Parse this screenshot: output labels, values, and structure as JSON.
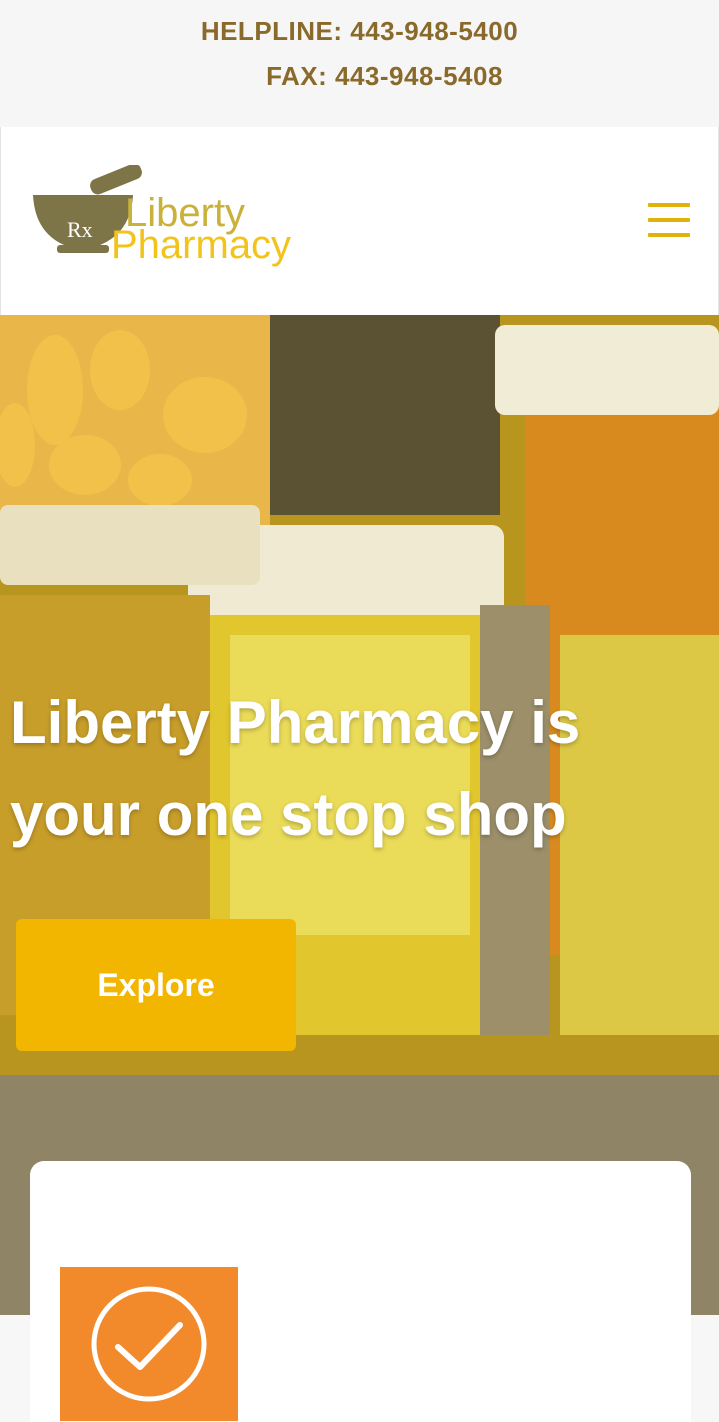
{
  "topbar": {
    "helpline": "HELPLINE: 443-948-5400",
    "fax": "FAX: 443-948-5408"
  },
  "logo": {
    "line1": "Liberty",
    "line2": "Pharmacy",
    "icon": "mortar-pestle-icon",
    "rx": "Rx"
  },
  "menu": {
    "icon": "hamburger-menu-icon"
  },
  "hero": {
    "title": "Liberty Pharmacy is your one stop shop",
    "button_label": "Explore"
  },
  "feature": {
    "icon": "check-circle-icon"
  },
  "colors": {
    "topbar_text": "#8a6a2a",
    "accent": "#f3b600",
    "menu": "#e1b20a",
    "feature_tile": "#f28a2b"
  }
}
